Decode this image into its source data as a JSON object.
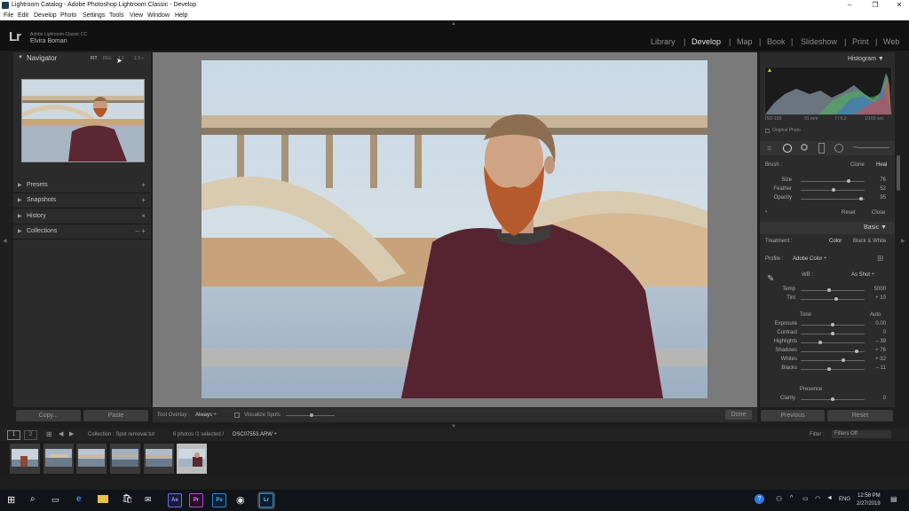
{
  "window": {
    "title": "Lightroom Catalog - Adobe Photoshop Lightroom Classic - Develop"
  },
  "menu": [
    "File",
    "Edit",
    "Develop",
    "Photo",
    "Settings",
    "Tools",
    "View",
    "Window",
    "Help"
  ],
  "identity": {
    "logo": "Lr",
    "product": "Adobe Lightroom Classic CC",
    "user": "Elvira Boman"
  },
  "modules": [
    {
      "label": "Library",
      "active": false
    },
    {
      "label": "Develop",
      "active": true
    },
    {
      "label": "Map",
      "active": false
    },
    {
      "label": "Book",
      "active": false
    },
    {
      "label": "Slideshow",
      "active": false
    },
    {
      "label": "Print",
      "active": false
    },
    {
      "label": "Web",
      "active": false
    }
  ],
  "navigator": {
    "title": "Navigator",
    "fit": "FIT",
    "fill": "FILL",
    "one": "1:1",
    "three": "1:3 ÷"
  },
  "left_sections": [
    {
      "label": "Presets",
      "action": "+"
    },
    {
      "label": "Snapshots",
      "action": "+"
    },
    {
      "label": "History",
      "action": "×"
    },
    {
      "label": "Collections",
      "action": "– +"
    }
  ],
  "left_buttons": {
    "copy": "Copy...",
    "paste": "Paste"
  },
  "toolbar": {
    "overlay_label": "Tool Overlay :",
    "overlay_value": "Always ÷",
    "visualize": "Visualize Spots",
    "done": "Done"
  },
  "histogram": {
    "title": "Histogram ▼",
    "iso": "ISO 100",
    "focal": "91 mm",
    "aperture": "f / 6.3",
    "shutter": "1/160 sec",
    "original": "Original Photo"
  },
  "brush": {
    "label": "Brush :",
    "clone": "Clone",
    "heal": "Heal",
    "sliders": [
      {
        "name": "Size",
        "value": "76",
        "pos": 0.75
      },
      {
        "name": "Feather",
        "value": "52",
        "pos": 0.52
      },
      {
        "name": "Opacity",
        "value": "95",
        "pos": 0.95
      }
    ],
    "reset": "Reset",
    "close": "Close"
  },
  "basic": {
    "title": "Basic ▼",
    "treatment": "Treatment :",
    "color": "Color",
    "bw": "Black & White",
    "profile_label": "Profile :",
    "profile_value": "Adobe Color ÷",
    "wb_label": "WB :",
    "wb_value": "As Shot ÷",
    "wb_sliders": [
      {
        "name": "Temp",
        "value": "5000",
        "pos": 0.45
      },
      {
        "name": "Tint",
        "value": "+ 10",
        "pos": 0.55
      }
    ],
    "tone": "Tone",
    "auto": "Auto",
    "tone_sliders": [
      {
        "name": "Exposure",
        "value": "0.00",
        "pos": 0.5
      },
      {
        "name": "Contrast",
        "value": "0",
        "pos": 0.5
      },
      {
        "name": "Highlights",
        "value": "– 39",
        "pos": 0.3
      },
      {
        "name": "Shadows",
        "value": "+ 76",
        "pos": 0.88
      },
      {
        "name": "Whites",
        "value": "+ 32",
        "pos": 0.66
      },
      {
        "name": "Blacks",
        "value": "– 11",
        "pos": 0.45
      }
    ],
    "presence": "Presence",
    "presence_sliders": [
      {
        "name": "Clarity",
        "value": "0",
        "pos": 0.5
      }
    ]
  },
  "right_buttons": {
    "previous": "Previous",
    "reset": "Reset"
  },
  "filmstrip": {
    "collection": "Collection : Spot removal tut",
    "count": "6 photos /1 selected /",
    "file": "DSC07553.ARW ÷",
    "filter_label": "Filter :",
    "filter_value": "Filters Off",
    "thumbs": [
      {
        "selected": false
      },
      {
        "selected": false
      },
      {
        "selected": false
      },
      {
        "selected": false
      },
      {
        "selected": false
      },
      {
        "selected": true
      }
    ]
  },
  "taskbar": {
    "apps": [
      "Ae",
      "Pr",
      "Ps",
      "Lr"
    ],
    "lang": "ENG",
    "time": "12:58 PM",
    "date": "2/27/2019"
  }
}
